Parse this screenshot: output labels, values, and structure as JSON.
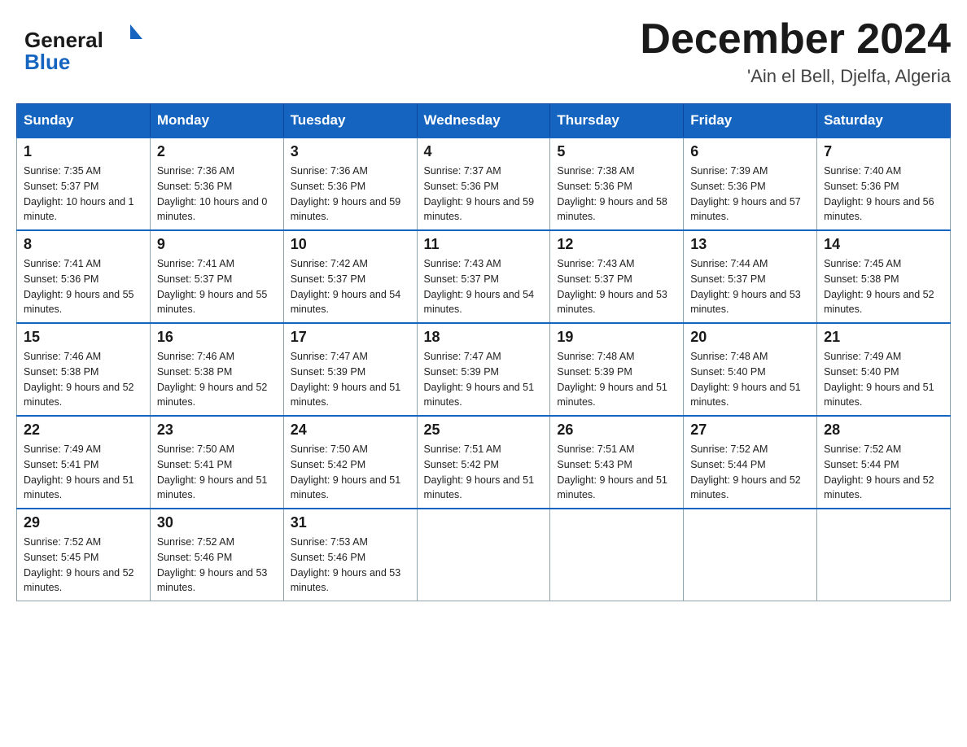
{
  "header": {
    "logo_general": "General",
    "logo_blue": "Blue",
    "month_title": "December 2024",
    "location": "'Ain el Bell, Djelfa, Algeria"
  },
  "days_of_week": [
    "Sunday",
    "Monday",
    "Tuesday",
    "Wednesday",
    "Thursday",
    "Friday",
    "Saturday"
  ],
  "weeks": [
    [
      {
        "day": "1",
        "sunrise": "7:35 AM",
        "sunset": "5:37 PM",
        "daylight": "10 hours and 1 minute."
      },
      {
        "day": "2",
        "sunrise": "7:36 AM",
        "sunset": "5:36 PM",
        "daylight": "10 hours and 0 minutes."
      },
      {
        "day": "3",
        "sunrise": "7:36 AM",
        "sunset": "5:36 PM",
        "daylight": "9 hours and 59 minutes."
      },
      {
        "day": "4",
        "sunrise": "7:37 AM",
        "sunset": "5:36 PM",
        "daylight": "9 hours and 59 minutes."
      },
      {
        "day": "5",
        "sunrise": "7:38 AM",
        "sunset": "5:36 PM",
        "daylight": "9 hours and 58 minutes."
      },
      {
        "day": "6",
        "sunrise": "7:39 AM",
        "sunset": "5:36 PM",
        "daylight": "9 hours and 57 minutes."
      },
      {
        "day": "7",
        "sunrise": "7:40 AM",
        "sunset": "5:36 PM",
        "daylight": "9 hours and 56 minutes."
      }
    ],
    [
      {
        "day": "8",
        "sunrise": "7:41 AM",
        "sunset": "5:36 PM",
        "daylight": "9 hours and 55 minutes."
      },
      {
        "day": "9",
        "sunrise": "7:41 AM",
        "sunset": "5:37 PM",
        "daylight": "9 hours and 55 minutes."
      },
      {
        "day": "10",
        "sunrise": "7:42 AM",
        "sunset": "5:37 PM",
        "daylight": "9 hours and 54 minutes."
      },
      {
        "day": "11",
        "sunrise": "7:43 AM",
        "sunset": "5:37 PM",
        "daylight": "9 hours and 54 minutes."
      },
      {
        "day": "12",
        "sunrise": "7:43 AM",
        "sunset": "5:37 PM",
        "daylight": "9 hours and 53 minutes."
      },
      {
        "day": "13",
        "sunrise": "7:44 AM",
        "sunset": "5:37 PM",
        "daylight": "9 hours and 53 minutes."
      },
      {
        "day": "14",
        "sunrise": "7:45 AM",
        "sunset": "5:38 PM",
        "daylight": "9 hours and 52 minutes."
      }
    ],
    [
      {
        "day": "15",
        "sunrise": "7:46 AM",
        "sunset": "5:38 PM",
        "daylight": "9 hours and 52 minutes."
      },
      {
        "day": "16",
        "sunrise": "7:46 AM",
        "sunset": "5:38 PM",
        "daylight": "9 hours and 52 minutes."
      },
      {
        "day": "17",
        "sunrise": "7:47 AM",
        "sunset": "5:39 PM",
        "daylight": "9 hours and 51 minutes."
      },
      {
        "day": "18",
        "sunrise": "7:47 AM",
        "sunset": "5:39 PM",
        "daylight": "9 hours and 51 minutes."
      },
      {
        "day": "19",
        "sunrise": "7:48 AM",
        "sunset": "5:39 PM",
        "daylight": "9 hours and 51 minutes."
      },
      {
        "day": "20",
        "sunrise": "7:48 AM",
        "sunset": "5:40 PM",
        "daylight": "9 hours and 51 minutes."
      },
      {
        "day": "21",
        "sunrise": "7:49 AM",
        "sunset": "5:40 PM",
        "daylight": "9 hours and 51 minutes."
      }
    ],
    [
      {
        "day": "22",
        "sunrise": "7:49 AM",
        "sunset": "5:41 PM",
        "daylight": "9 hours and 51 minutes."
      },
      {
        "day": "23",
        "sunrise": "7:50 AM",
        "sunset": "5:41 PM",
        "daylight": "9 hours and 51 minutes."
      },
      {
        "day": "24",
        "sunrise": "7:50 AM",
        "sunset": "5:42 PM",
        "daylight": "9 hours and 51 minutes."
      },
      {
        "day": "25",
        "sunrise": "7:51 AM",
        "sunset": "5:42 PM",
        "daylight": "9 hours and 51 minutes."
      },
      {
        "day": "26",
        "sunrise": "7:51 AM",
        "sunset": "5:43 PM",
        "daylight": "9 hours and 51 minutes."
      },
      {
        "day": "27",
        "sunrise": "7:52 AM",
        "sunset": "5:44 PM",
        "daylight": "9 hours and 52 minutes."
      },
      {
        "day": "28",
        "sunrise": "7:52 AM",
        "sunset": "5:44 PM",
        "daylight": "9 hours and 52 minutes."
      }
    ],
    [
      {
        "day": "29",
        "sunrise": "7:52 AM",
        "sunset": "5:45 PM",
        "daylight": "9 hours and 52 minutes."
      },
      {
        "day": "30",
        "sunrise": "7:52 AM",
        "sunset": "5:46 PM",
        "daylight": "9 hours and 53 minutes."
      },
      {
        "day": "31",
        "sunrise": "7:53 AM",
        "sunset": "5:46 PM",
        "daylight": "9 hours and 53 minutes."
      },
      null,
      null,
      null,
      null
    ]
  ]
}
